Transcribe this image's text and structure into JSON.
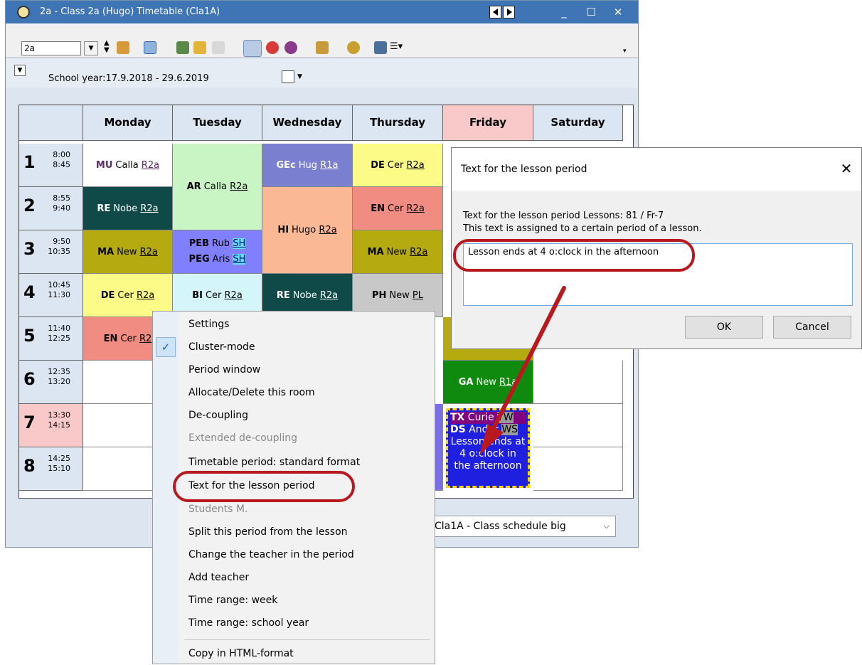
{
  "window": {
    "title": "2a - Class 2a (Hugo)  Timetable  (Cla1A)",
    "class_select": "2a",
    "school_year": "School year:17.9.2018 - 29.6.2019",
    "format_select": "Cla1A - Class schedule big"
  },
  "days": [
    "Monday",
    "Tuesday",
    "Wednesday",
    "Thursday",
    "Friday",
    "Saturday"
  ],
  "periods": [
    {
      "num": "1",
      "start": "8:00",
      "end": "8:45"
    },
    {
      "num": "2",
      "start": "8:55",
      "end": "9:40"
    },
    {
      "num": "3",
      "start": "9:50",
      "end": "10:35"
    },
    {
      "num": "4",
      "start": "10:45",
      "end": "11:30"
    },
    {
      "num": "5",
      "start": "11:40",
      "end": "12:25"
    },
    {
      "num": "6",
      "start": "12:35",
      "end": "13:20"
    },
    {
      "num": "7",
      "start": "13:30",
      "end": "14:15"
    },
    {
      "num": "8",
      "start": "14:25",
      "end": "15:10"
    }
  ],
  "lessons": {
    "mon1": {
      "subj": "MU",
      "teacher": "Calla",
      "room": "R2a"
    },
    "mon2": {
      "subj": "RE",
      "teacher": "Nobe",
      "room": "R2a"
    },
    "mon3": {
      "subj": "MA",
      "teacher": "New",
      "room": "R2a"
    },
    "mon4": {
      "subj": "DE",
      "teacher": "Cer",
      "room": "R2a"
    },
    "mon5": {
      "subj": "EN",
      "teacher": "Cer",
      "room": "R2"
    },
    "tue12": {
      "subj": "AR",
      "teacher": "Calla",
      "room": "R2a"
    },
    "tue3a": {
      "subj": "PEB",
      "teacher": "Rub",
      "room": "SH"
    },
    "tue3b": {
      "subj": "PEG",
      "teacher": "Aris",
      "room": "SH"
    },
    "tue4": {
      "subj": "BI",
      "teacher": "Cer",
      "room": "R2a"
    },
    "wed1": {
      "subj": "GEc",
      "teacher": "Hug",
      "room": "R1a"
    },
    "wed23": {
      "subj": "HI",
      "teacher": "Hugo",
      "room": "R2a"
    },
    "wed4": {
      "subj": "RE",
      "teacher": "Nobe",
      "room": "R2a"
    },
    "thu1": {
      "subj": "DE",
      "teacher": "Cer",
      "room": "R2a"
    },
    "thu2": {
      "subj": "EN",
      "teacher": "Cer",
      "room": "R2a"
    },
    "thu3": {
      "subj": "MA",
      "teacher": "New",
      "room": "R2a"
    },
    "thu4": {
      "subj": "PH",
      "teacher": "New",
      "room": "PL"
    },
    "fri6": {
      "subj": "GA",
      "teacher": "New",
      "room": "R1a"
    },
    "fri78a": {
      "subj": "TX",
      "teacher": "Curie",
      "room": "TW"
    },
    "fri78b": {
      "subj": "DS",
      "teacher": "Ander",
      "room": "WS"
    },
    "fri78_text": "Lesson ends at 4 o:clock in the afternoon"
  },
  "context_menu": [
    {
      "label": "Settings",
      "disabled": false,
      "checked": false
    },
    {
      "label": "Cluster-mode",
      "disabled": false,
      "checked": true
    },
    {
      "label": "Period window",
      "disabled": false,
      "checked": false
    },
    {
      "label": "Allocate/Delete this room",
      "disabled": false,
      "checked": false
    },
    {
      "label": "De-coupling",
      "disabled": false,
      "checked": false
    },
    {
      "label": "Extended de-coupling",
      "disabled": true,
      "checked": false
    },
    {
      "label": "Timetable period: standard format",
      "disabled": false,
      "checked": false
    },
    {
      "label": "Text for the lesson period",
      "disabled": false,
      "checked": false
    },
    {
      "label": "Students M.",
      "disabled": true,
      "checked": false
    },
    {
      "label": "Split this period from the lesson",
      "disabled": false,
      "checked": false
    },
    {
      "label": "Change the teacher in the period",
      "disabled": false,
      "checked": false
    },
    {
      "label": "Add teacher",
      "disabled": false,
      "checked": false
    },
    {
      "label": "Time range: week",
      "disabled": false,
      "checked": false
    },
    {
      "label": "Time range: school year",
      "disabled": false,
      "checked": false
    },
    {
      "label": "Copy in HTML-format",
      "disabled": false,
      "checked": false
    }
  ],
  "dialog": {
    "title": "Text for the lesson period",
    "info_line1": "Text for the lesson period  Lessons: 81 / Fr-7",
    "info_line2": "This text is assigned to a certain period of a lesson.",
    "text_value": "Lesson ends at 4 o:clock in the afternoon",
    "ok_label": "OK",
    "cancel_label": "Cancel"
  },
  "colors": {
    "titlebar": "#3f74b5",
    "annotation": "#b8191f"
  }
}
